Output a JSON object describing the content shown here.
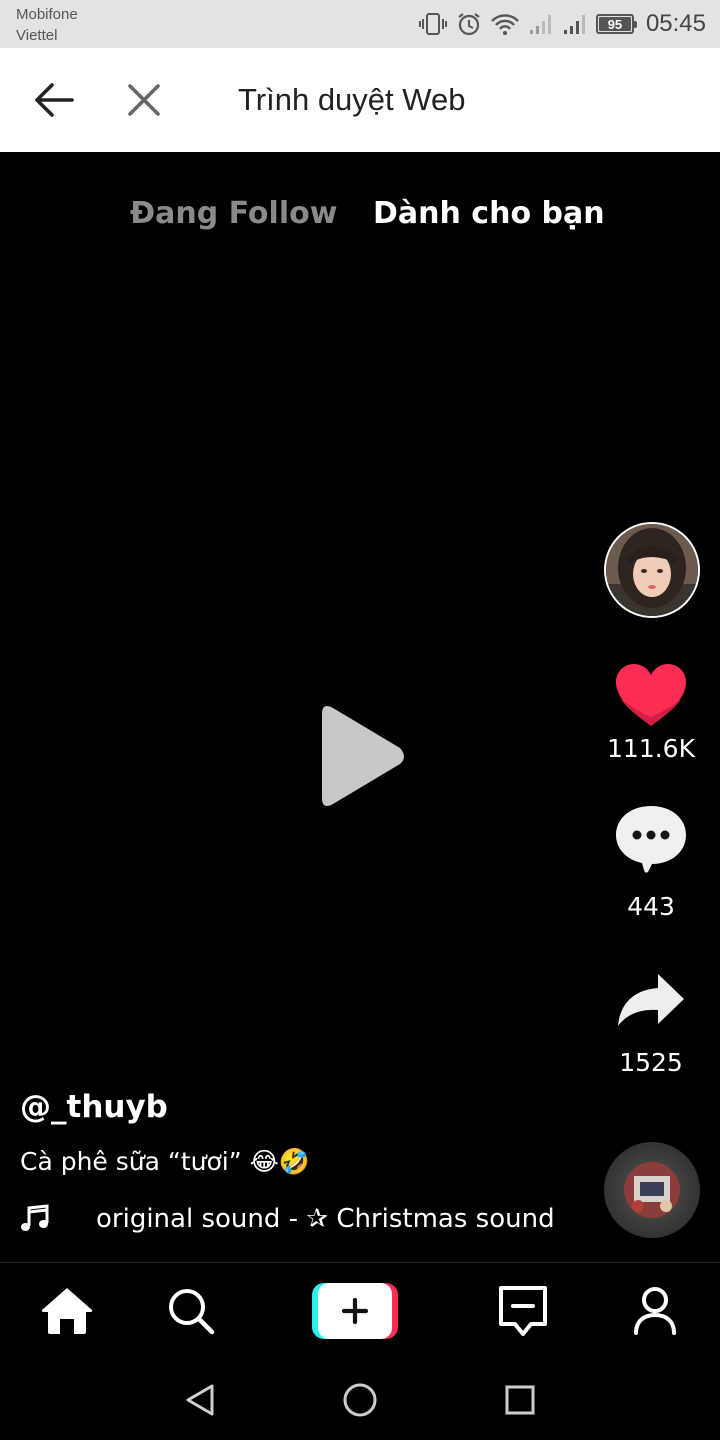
{
  "status_bar": {
    "carrier_1": "Mobifone",
    "carrier_2": "Viettel",
    "battery_level": "95",
    "time": "05:45"
  },
  "browser_bar": {
    "title": "Trình duyệt Web"
  },
  "feed_tabs": {
    "following": "Đang Follow",
    "for_you": "Dành cho bạn"
  },
  "video": {
    "username": "@_thuyb",
    "caption": "Cà phê sữa “tươi” 😂🤣",
    "sound": "original sound - ✰ Christmas sound",
    "likes": "111.6K",
    "comments": "443",
    "shares": "1525"
  },
  "colors": {
    "like_red": "#fe2c55",
    "create_cyan": "#25f4ee",
    "create_pink": "#fe2c55"
  }
}
